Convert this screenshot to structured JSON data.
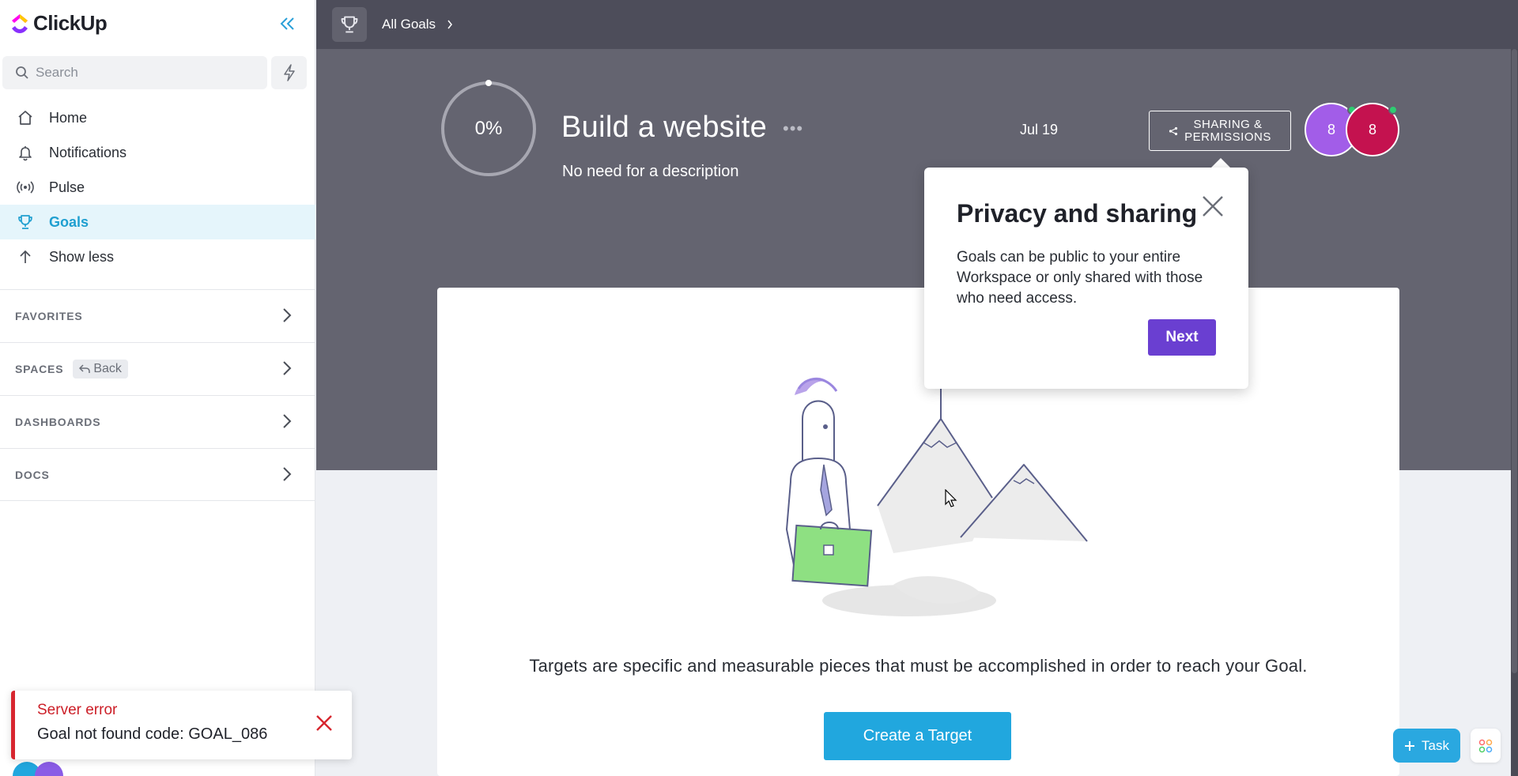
{
  "app": {
    "name": "ClickUp"
  },
  "sidebar": {
    "search_placeholder": "Search",
    "nav": [
      {
        "label": "Home",
        "icon": "home-icon"
      },
      {
        "label": "Notifications",
        "icon": "bell-icon"
      },
      {
        "label": "Pulse",
        "icon": "pulse-icon"
      },
      {
        "label": "Goals",
        "icon": "trophy-icon",
        "active": true
      },
      {
        "label": "Show less",
        "icon": "arrow-up-icon"
      }
    ],
    "sections": [
      {
        "title": "FAVORITES"
      },
      {
        "title": "SPACES",
        "pill": "Back"
      },
      {
        "title": "DASHBOARDS"
      },
      {
        "title": "DOCS"
      }
    ]
  },
  "toast": {
    "title": "Server error",
    "message": "Goal not found code: GOAL_086"
  },
  "topbar": {
    "breadcrumb": "All Goals"
  },
  "goal": {
    "progress_label": "0%",
    "progress": 0,
    "title": "Build a website",
    "more": "•••",
    "description": "No need for a description",
    "date": "Jul 19",
    "share_line1": "SHARING &",
    "share_line2": "PERMISSIONS",
    "avatars": [
      {
        "label": "8",
        "color": "#a25de8"
      },
      {
        "label": "8",
        "color": "#c4124f"
      }
    ]
  },
  "popover": {
    "title": "Privacy and sharing",
    "body": "Goals can be public to your entire Workspace or only shared with those who need access.",
    "next": "Next"
  },
  "card": {
    "targets_text": "Targets are specific and measurable pieces that must be accomplished in order to reach your Goal.",
    "create_button": "Create a Target"
  },
  "footer": {
    "task_button": "Task"
  },
  "colors": {
    "accent": "#21a7de",
    "purple": "#6a3fd1",
    "error": "#d7262f"
  }
}
